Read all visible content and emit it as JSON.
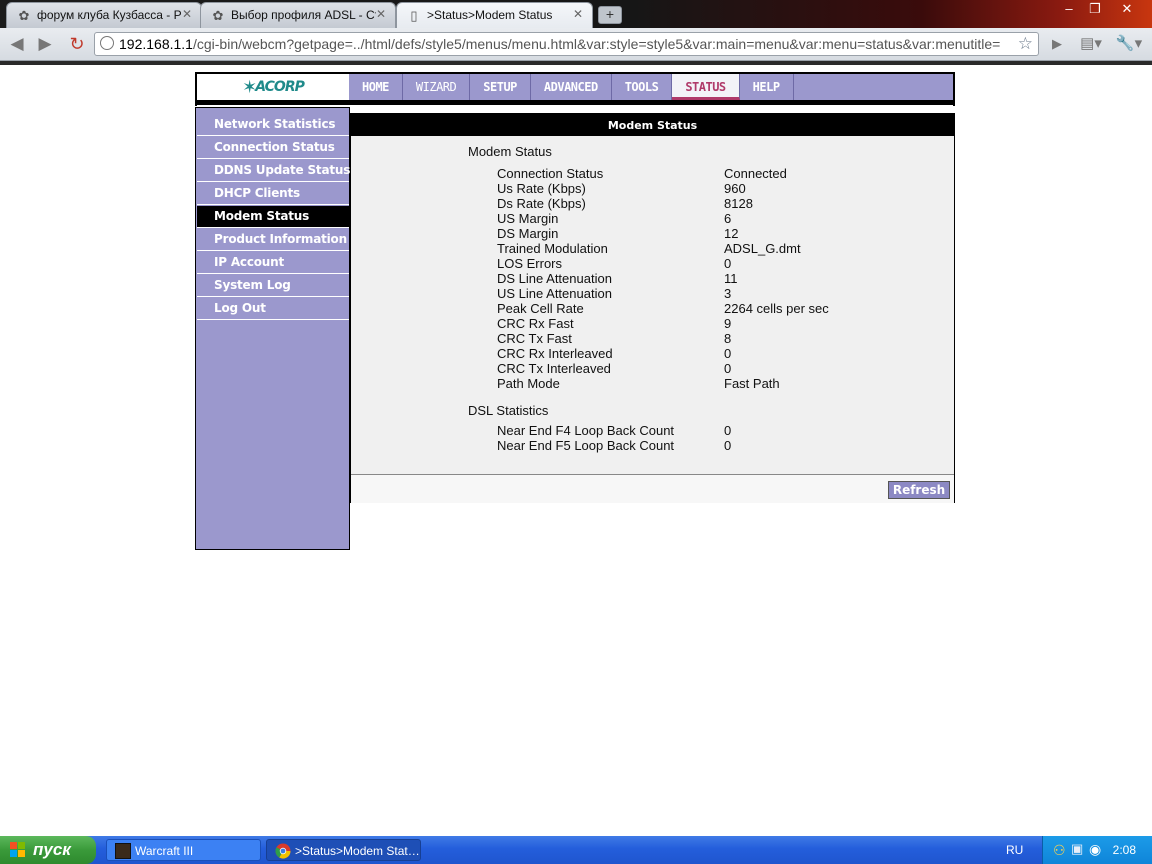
{
  "browser": {
    "tabs": [
      {
        "title": "форум клуба Кузбасса - Р…",
        "active": false
      },
      {
        "title": "Выбор профиля ADSL - Ст…",
        "active": false
      },
      {
        "title": ">Status>Modem Status",
        "active": true
      }
    ],
    "url_host": "192.168.1.1",
    "url_path": "/cgi-bin/webcm?getpage=../html/defs/style5/menus/menu.html&var:style=style5&var:main=menu&var:menu=status&var:menutitle="
  },
  "router": {
    "logo": "ACORP",
    "nav": [
      "HOME",
      "WIZARD",
      "SETUP",
      "ADVANCED",
      "TOOLS",
      "STATUS",
      "HELP"
    ],
    "nav_active": "STATUS",
    "sidebar": [
      "Network Statistics",
      "Connection Status",
      "DDNS Update Status",
      "DHCP Clients",
      "Modem Status",
      "Product Information",
      "IP Account",
      "System Log",
      "Log Out"
    ],
    "sidebar_active": "Modem Status",
    "panel_title": "Modem Status",
    "modem_section": "Modem Status",
    "modem_rows": [
      {
        "label": "Connection Status",
        "value": "Connected"
      },
      {
        "label": "Us Rate (Kbps)",
        "value": "960"
      },
      {
        "label": "Ds Rate (Kbps)",
        "value": "8128"
      },
      {
        "label": "US Margin",
        "value": "6"
      },
      {
        "label": "DS Margin",
        "value": "12"
      },
      {
        "label": "Trained Modulation",
        "value": "ADSL_G.dmt"
      },
      {
        "label": "LOS Errors",
        "value": "0"
      },
      {
        "label": "DS Line Attenuation",
        "value": "11"
      },
      {
        "label": "US Line Attenuation",
        "value": "3"
      },
      {
        "label": "Peak Cell Rate",
        "value": "2264 cells per sec"
      },
      {
        "label": "CRC Rx Fast",
        "value": "9"
      },
      {
        "label": "CRC Tx Fast",
        "value": "8"
      },
      {
        "label": "CRC Rx Interleaved",
        "value": "0"
      },
      {
        "label": "CRC Tx Interleaved",
        "value": "0"
      },
      {
        "label": "Path Mode",
        "value": "Fast Path"
      }
    ],
    "dsl_section": "DSL Statistics",
    "dsl_rows": [
      {
        "label": "Near End F4 Loop Back Count",
        "value": "0"
      },
      {
        "label": "Near End F5 Loop Back Count",
        "value": "0"
      }
    ],
    "refresh_label": "Refresh"
  },
  "taskbar": {
    "start_label": "пуск",
    "tasks": [
      {
        "title": "Warcraft III",
        "active": false
      },
      {
        "title": ">Status>Modem Stat…",
        "active": true
      }
    ],
    "lang": "RU",
    "clock": "2:08"
  },
  "colors": {
    "nav_bg": "#9b98cd",
    "active_nav_text": "#b03a6a",
    "logo": "#1f8a8a",
    "taskbar": "#245edb"
  }
}
